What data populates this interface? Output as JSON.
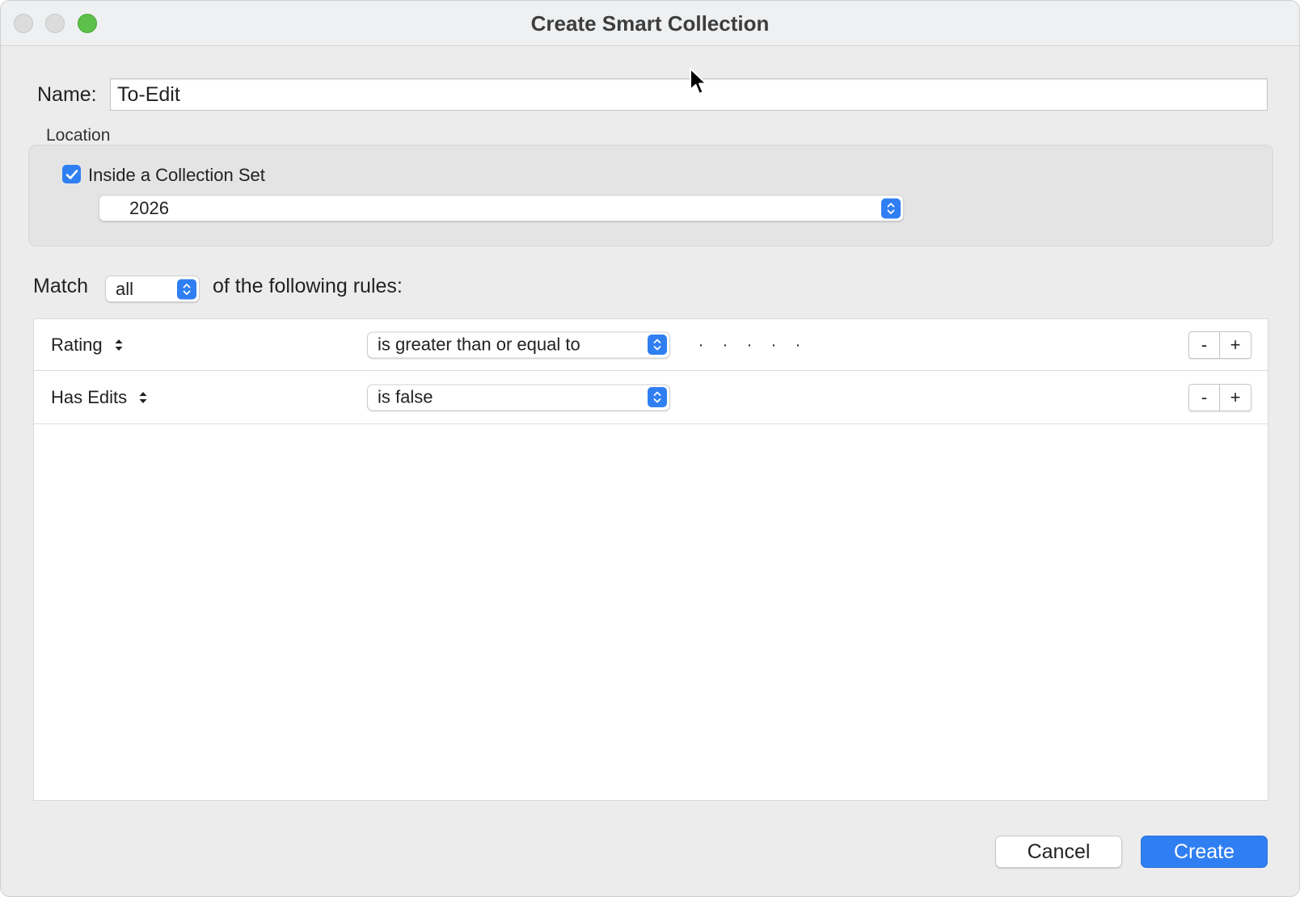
{
  "window": {
    "title": "Create Smart Collection"
  },
  "name": {
    "label": "Name:",
    "value": "To-Edit"
  },
  "location": {
    "label": "Location",
    "checkbox_label": "Inside a Collection Set",
    "checked": true,
    "collection_set": "2026"
  },
  "match": {
    "label": "Match",
    "value": "all",
    "suffix": "of the following rules:"
  },
  "rules": [
    {
      "field": "Rating",
      "operator": "is greater than or equal to",
      "rating_stars": 0,
      "rating_max": 5,
      "minus_label": "-",
      "plus_label": "+"
    },
    {
      "field": "Has Edits",
      "operator": "is false",
      "minus_label": "-",
      "plus_label": "+"
    }
  ],
  "footer": {
    "cancel_label": "Cancel",
    "create_label": "Create"
  },
  "colors": {
    "accent": "#2f7ff2",
    "zoom_button": "#5dc04a"
  }
}
